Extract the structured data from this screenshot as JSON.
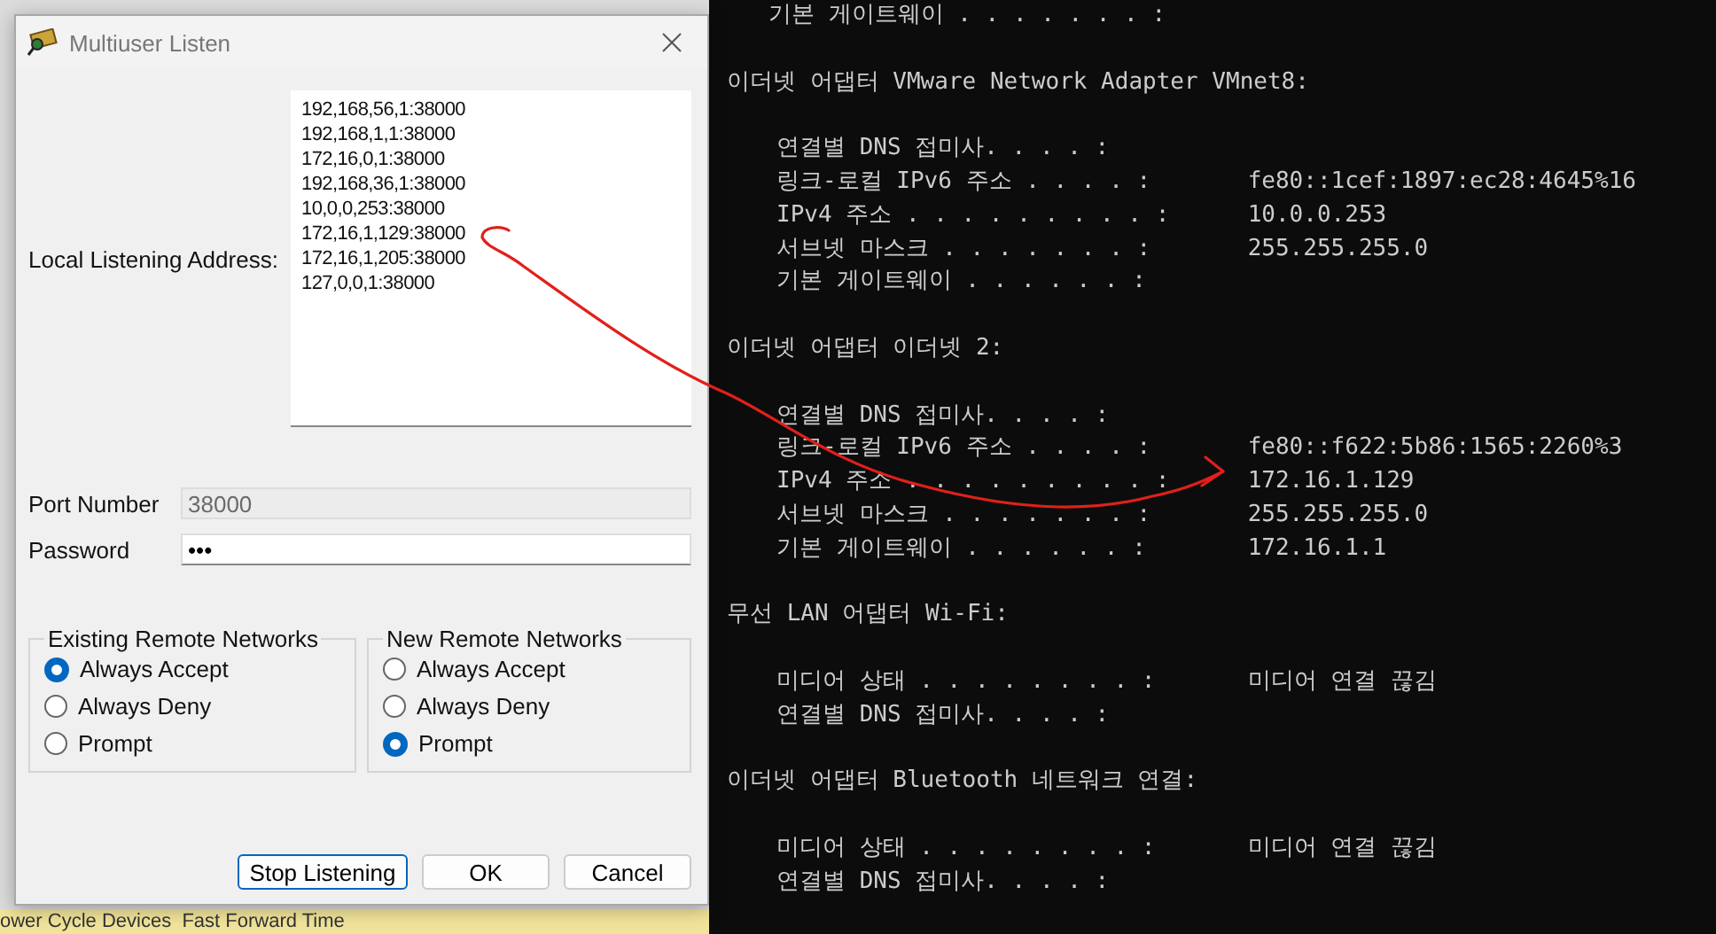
{
  "background_app": {
    "status_bar": "ower Cycle Devices  Fast Forward Time"
  },
  "dialog": {
    "title": "Multiuser Listen",
    "address_label": "Local Listening Address:",
    "addresses": [
      "192,168,56,1:38000",
      "192,168,1,1:38000",
      "172,16,0,1:38000",
      "192,168,36,1:38000",
      "10,0,0,253:38000",
      "172,16,1,129:38000",
      "172,16,1,205:38000",
      "127,0,0,1:38000"
    ],
    "port": {
      "label": "Port Number",
      "value": "38000",
      "disabled": true
    },
    "password": {
      "label": "Password",
      "value": "•••"
    },
    "groups": [
      {
        "title": "Existing Remote Networks",
        "options": [
          {
            "label": "Always Accept",
            "selected": true
          },
          {
            "label": "Always Deny",
            "selected": false
          },
          {
            "label": "Prompt",
            "selected": false
          }
        ]
      },
      {
        "title": "New Remote Networks",
        "options": [
          {
            "label": "Always Accept",
            "selected": false
          },
          {
            "label": "Always Deny",
            "selected": false
          },
          {
            "label": "Prompt",
            "selected": true
          }
        ]
      }
    ],
    "buttons": [
      {
        "label": "Stop Listening",
        "focused": true
      },
      {
        "label": "OK",
        "focused": false
      },
      {
        "label": "Cancel",
        "focused": false
      }
    ]
  },
  "terminal": {
    "top_line": "기본 게이트웨이 . . . . . . . :",
    "sections": [
      {
        "header": "이더넷 어댑터 VMware Network Adapter VMnet8:",
        "entries": [
          {
            "label": "연결별 DNS 접미사. . . . :"
          },
          {
            "label": "링크-로컬 IPv6 주소 . . . . :",
            "value": "fe80::1cef:1897:ec28:4645%16"
          },
          {
            "label": "IPv4 주소 . . . . . . . . . :",
            "value": "10.0.0.253"
          },
          {
            "label": "서브넷 마스크 . . . . . . . :",
            "value": "255.255.255.0"
          },
          {
            "label": "기본 게이트웨이 . . . . . . :"
          }
        ]
      },
      {
        "header": "이더넷 어댑터 이더넷 2:",
        "entries": [
          {
            "label": "연결별 DNS 접미사. . . . :"
          },
          {
            "label": "링크-로컬 IPv6 주소 . . . . :",
            "value": "fe80::f622:5b86:1565:2260%3"
          },
          {
            "label": "IPv4 주소 . . . . . . . . . :",
            "value": "172.16.1.129"
          },
          {
            "label": "서브넷 마스크 . . . . . . . :",
            "value": "255.255.255.0"
          },
          {
            "label": "기본 게이트웨이 . . . . . . :",
            "value": "172.16.1.1"
          }
        ]
      },
      {
        "header": "무선 LAN 어댑터 Wi-Fi:",
        "entries": [
          {
            "label": "미디어 상태 . . . . . . . . :",
            "value": "미디어 연결 끊김"
          },
          {
            "label": "연결별 DNS 접미사. . . . :"
          }
        ]
      },
      {
        "header": "이더넷 어댑터 Bluetooth 네트워크 연결:",
        "entries": [
          {
            "label": "미디어 상태 . . . . . . . . :",
            "value": "미디어 연결 끊김"
          },
          {
            "label": "연결별 DNS 접미사. . . . :"
          }
        ]
      }
    ]
  }
}
